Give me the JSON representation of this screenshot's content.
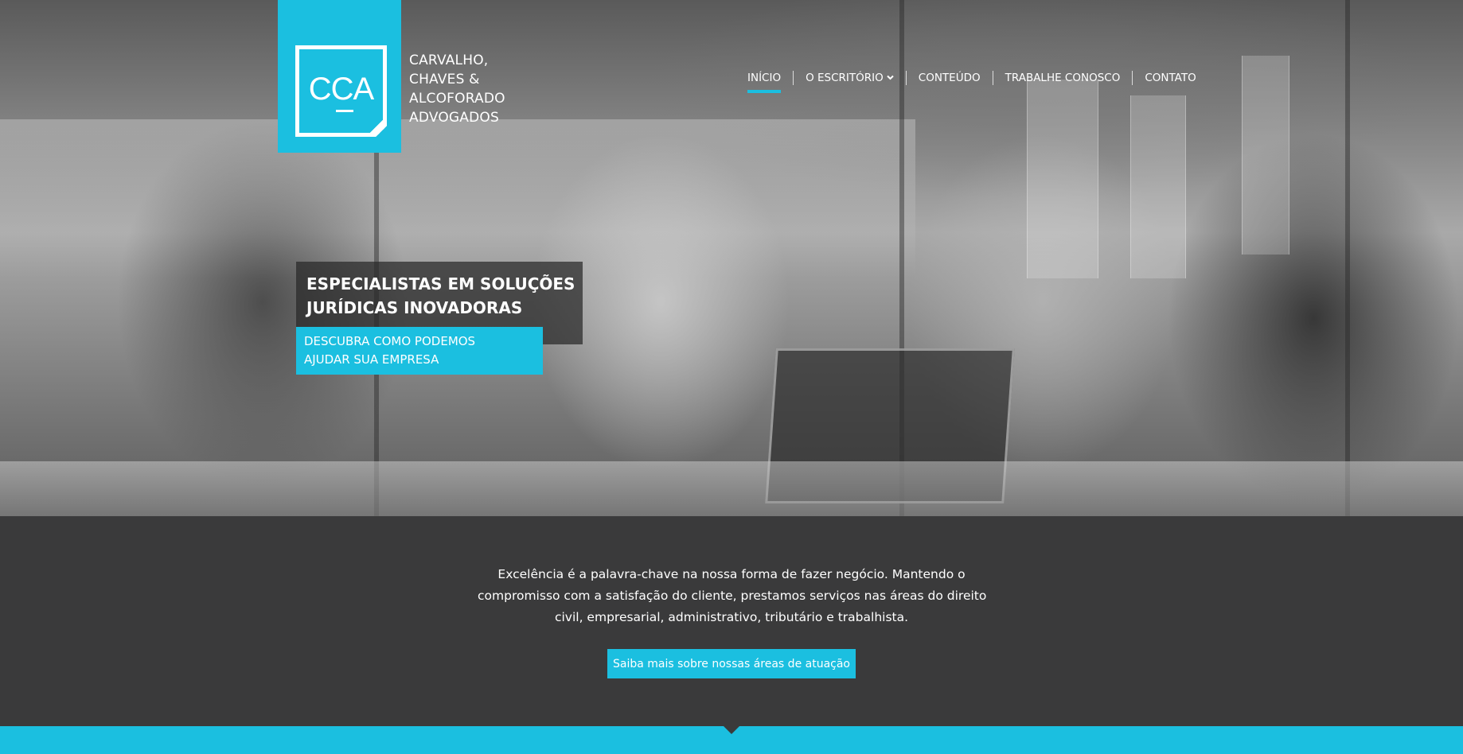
{
  "logo": {
    "mark": "CCA",
    "name_lines": [
      "CARVALHO,",
      "CHAVES &",
      "ALCOFORADO",
      "ADVOGADOS"
    ]
  },
  "nav": {
    "items": [
      {
        "label": "INÍCIO",
        "active": true
      },
      {
        "label": "O ESCRITÓRIO",
        "dropdown": true
      },
      {
        "label": "CONTEÚDO"
      },
      {
        "label": "TRABALHE CONOSCO"
      },
      {
        "label": "CONTATO"
      }
    ],
    "dropdown_icon": "chevron-down-icon"
  },
  "hero": {
    "headline_lines": [
      "ESPECIALISTAS EM SOLUÇÕES",
      "JURÍDICAS INOVADORAS"
    ],
    "cta_lines": [
      "DESCUBRA COMO PODEMOS",
      "AJUDAR SUA EMPRESA"
    ]
  },
  "intro": {
    "text_lines": [
      "Excelência é a palavra-chave na nossa forma de fazer negócio. Mantendo o",
      "compromisso com a satisfação do cliente, prestamos serviços nas áreas do direito",
      "civil, empresarial, administrativo, tributário e trabalhista."
    ],
    "button_label": "Saiba mais sobre nossas áreas de atuação"
  },
  "colors": {
    "accent": "#1bbfe0",
    "dark_background": "#3a3a3b"
  }
}
